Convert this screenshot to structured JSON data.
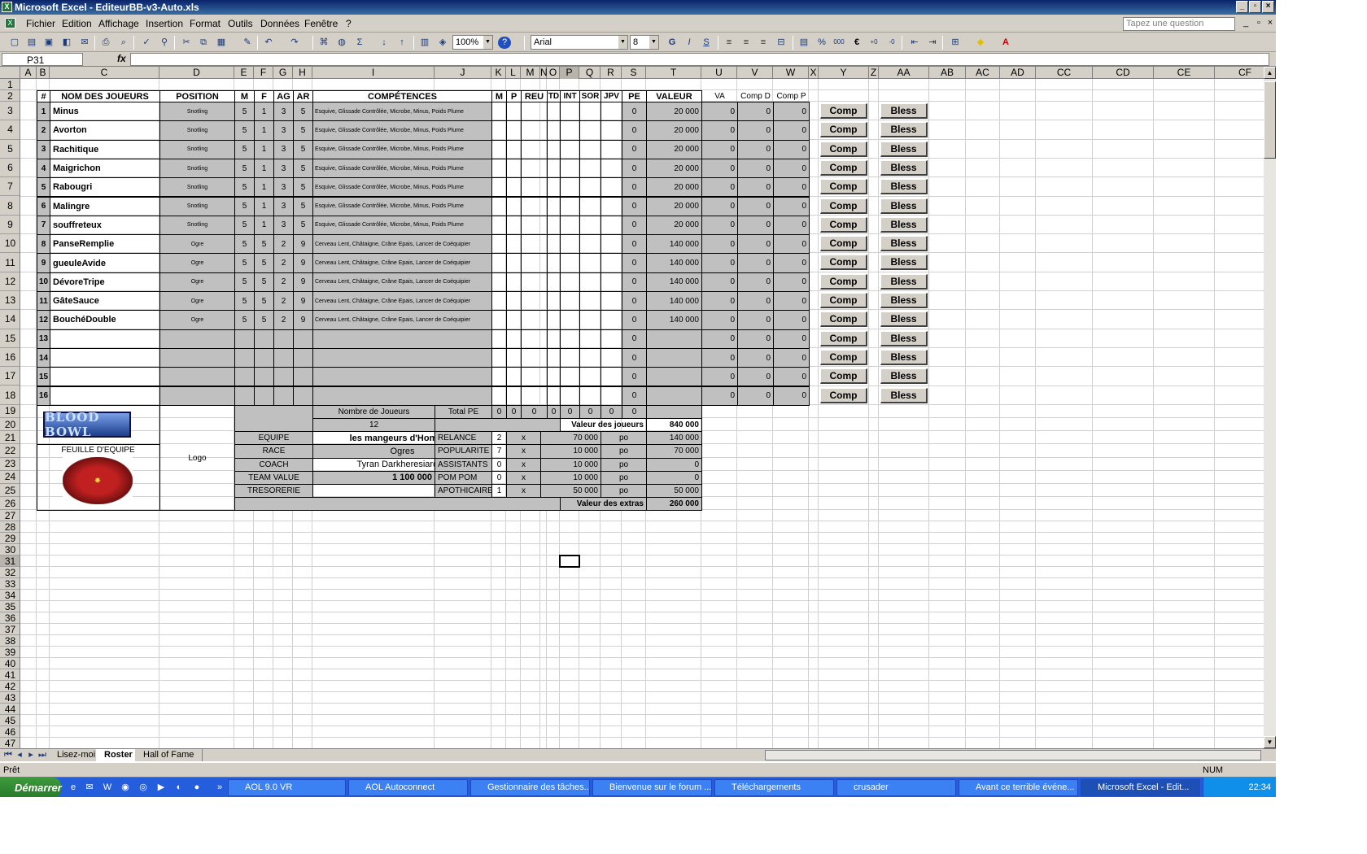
{
  "window": {
    "title": "Microsoft Excel - EditeurBB-v3-Auto.xls"
  },
  "menu": [
    "Fichier",
    "Edition",
    "Affichage",
    "Insertion",
    "Format",
    "Outils",
    "Données",
    "Fenêtre",
    "?"
  ],
  "ask": "Tapez une question",
  "toolbar": {
    "zoom": "100%",
    "font": "Arial",
    "size": "8",
    "euro": "€"
  },
  "namebox": "P31",
  "fx": "fx",
  "columns": [
    "A",
    "B",
    "C",
    "D",
    "E",
    "F",
    "G",
    "H",
    "I",
    "J",
    "K",
    "L",
    "M",
    "N",
    "O",
    "P",
    "Q",
    "R",
    "S",
    "T",
    "U",
    "V",
    "W",
    "X",
    "Y",
    "Z",
    "AA",
    "AB",
    "AC",
    "AD",
    "CC",
    "CD",
    "CE",
    "CF"
  ],
  "rownums": [
    "1",
    "2",
    "3",
    "4",
    "5",
    "6",
    "7",
    "8",
    "9",
    "10",
    "11",
    "12",
    "13",
    "14",
    "15",
    "16",
    "17",
    "18",
    "19",
    "20",
    "21",
    "22",
    "23",
    "24",
    "25",
    "26",
    "27",
    "28",
    "29",
    "30",
    "31",
    "32",
    "33",
    "34",
    "35",
    "36",
    "37",
    "38",
    "39",
    "40",
    "41",
    "42",
    "43",
    "44",
    "45",
    "46",
    "47"
  ],
  "headers": {
    "num": "#",
    "name": "NOM DES JOUEURS",
    "position": "POSITION",
    "m": "M",
    "f": "F",
    "ag": "AG",
    "ar": "AR",
    "comp": "COMPÉTENCES",
    "m2": "M",
    "p": "P",
    "reu": "REU",
    "td": "TD",
    "int": "INT",
    "sor": "SOR",
    "jpv": "JPV",
    "pe": "PE",
    "valeur": "VALEUR",
    "va": "VA",
    "compd": "Comp D",
    "compp": "Comp P"
  },
  "players": [
    {
      "n": "1",
      "name": "Minus",
      "pos": "Snotling",
      "m": "5",
      "f": "1",
      "ag": "3",
      "ar": "5",
      "comp": "Esquive, Glissade Contrôlée, Microbe, Minus, Poids Plume",
      "pe": "0",
      "val": "20 000",
      "va": "0",
      "cd": "0",
      "cp": "0"
    },
    {
      "n": "2",
      "name": "Avorton",
      "pos": "Snotling",
      "m": "5",
      "f": "1",
      "ag": "3",
      "ar": "5",
      "comp": "Esquive, Glissade Contrôlée, Microbe, Minus, Poids Plume",
      "pe": "0",
      "val": "20 000",
      "va": "0",
      "cd": "0",
      "cp": "0"
    },
    {
      "n": "3",
      "name": "Rachitique",
      "pos": "Snotling",
      "m": "5",
      "f": "1",
      "ag": "3",
      "ar": "5",
      "comp": "Esquive, Glissade Contrôlée, Microbe, Minus, Poids Plume",
      "pe": "0",
      "val": "20 000",
      "va": "0",
      "cd": "0",
      "cp": "0"
    },
    {
      "n": "4",
      "name": "Maigrichon",
      "pos": "Snotling",
      "m": "5",
      "f": "1",
      "ag": "3",
      "ar": "5",
      "comp": "Esquive, Glissade Contrôlée, Microbe, Minus, Poids Plume",
      "pe": "0",
      "val": "20 000",
      "va": "0",
      "cd": "0",
      "cp": "0"
    },
    {
      "n": "5",
      "name": "Rabougri",
      "pos": "Snotling",
      "m": "5",
      "f": "1",
      "ag": "3",
      "ar": "5",
      "comp": "Esquive, Glissade Contrôlée, Microbe, Minus, Poids Plume",
      "pe": "0",
      "val": "20 000",
      "va": "0",
      "cd": "0",
      "cp": "0"
    },
    {
      "n": "6",
      "name": "Malingre",
      "pos": "Snotling",
      "m": "5",
      "f": "1",
      "ag": "3",
      "ar": "5",
      "comp": "Esquive, Glissade Contrôlée, Microbe, Minus, Poids Plume",
      "pe": "0",
      "val": "20 000",
      "va": "0",
      "cd": "0",
      "cp": "0"
    },
    {
      "n": "7",
      "name": "souffreteux",
      "pos": "Snotling",
      "m": "5",
      "f": "1",
      "ag": "3",
      "ar": "5",
      "comp": "Esquive, Glissade Contrôlée, Microbe, Minus, Poids Plume",
      "pe": "0",
      "val": "20 000",
      "va": "0",
      "cd": "0",
      "cp": "0"
    },
    {
      "n": "8",
      "name": "PanseRemplie",
      "pos": "Ogre",
      "m": "5",
      "f": "5",
      "ag": "2",
      "ar": "9",
      "comp": "Cerveau Lent, Châtaigne, Crâne Epais, Lancer de Coéquipier",
      "pe": "0",
      "val": "140 000",
      "va": "0",
      "cd": "0",
      "cp": "0"
    },
    {
      "n": "9",
      "name": "gueuleAvide",
      "pos": "Ogre",
      "m": "5",
      "f": "5",
      "ag": "2",
      "ar": "9",
      "comp": "Cerveau Lent, Châtaigne, Crâne Epais, Lancer de Coéquipier",
      "pe": "0",
      "val": "140 000",
      "va": "0",
      "cd": "0",
      "cp": "0"
    },
    {
      "n": "10",
      "name": "DévoreTripe",
      "pos": "Ogre",
      "m": "5",
      "f": "5",
      "ag": "2",
      "ar": "9",
      "comp": "Cerveau Lent, Châtaigne, Crâne Epais, Lancer de Coéquipier",
      "pe": "0",
      "val": "140 000",
      "va": "0",
      "cd": "0",
      "cp": "0"
    },
    {
      "n": "11",
      "name": "GâteSauce",
      "pos": "Ogre",
      "m": "5",
      "f": "5",
      "ag": "2",
      "ar": "9",
      "comp": "Cerveau Lent, Châtaigne, Crâne Epais, Lancer de Coéquipier",
      "pe": "0",
      "val": "140 000",
      "va": "0",
      "cd": "0",
      "cp": "0"
    },
    {
      "n": "12",
      "name": "BouchéDouble",
      "pos": "Ogre",
      "m": "5",
      "f": "5",
      "ag": "2",
      "ar": "9",
      "comp": "Cerveau Lent, Châtaigne, Crâne Epais, Lancer de Coéquipier",
      "pe": "0",
      "val": "140 000",
      "va": "0",
      "cd": "0",
      "cp": "0"
    },
    {
      "n": "13",
      "name": "",
      "pos": "",
      "m": "",
      "f": "",
      "ag": "",
      "ar": "",
      "comp": "",
      "pe": "0",
      "val": "",
      "va": "0",
      "cd": "0",
      "cp": "0"
    },
    {
      "n": "14",
      "name": "",
      "pos": "",
      "m": "",
      "f": "",
      "ag": "",
      "ar": "",
      "comp": "",
      "pe": "0",
      "val": "",
      "va": "0",
      "cd": "0",
      "cp": "0"
    },
    {
      "n": "15",
      "name": "",
      "pos": "",
      "m": "",
      "f": "",
      "ag": "",
      "ar": "",
      "comp": "",
      "pe": "0",
      "val": "",
      "va": "0",
      "cd": "0",
      "cp": "0"
    },
    {
      "n": "16",
      "name": "",
      "pos": "",
      "m": "",
      "f": "",
      "ag": "",
      "ar": "",
      "comp": "",
      "pe": "0",
      "val": "",
      "va": "0",
      "cd": "0",
      "cp": "0"
    }
  ],
  "buttons": {
    "comp": "Comp",
    "bless": "Bless"
  },
  "team": {
    "bb_logo": "BLOOD BOWL",
    "feuille": "FEUILLE D'EQUIPE",
    "logo": "Logo",
    "nb_joueurs_label": "Nombre de Joueurs",
    "nb_joueurs": "12",
    "total_pe_label": "Total PE",
    "total_pe_vals": [
      "0",
      "0",
      "0",
      "0",
      "0",
      "0",
      "0",
      "0"
    ],
    "valeur_joueurs_label": "Valeur des joueurs",
    "valeur_joueurs": "840 000",
    "equipe_label": "EQUIPE",
    "equipe": "les mangeurs d'Hommes",
    "race_label": "RACE",
    "race": "Ogres",
    "coach_label": "COACH",
    "coach": "Tyran Darkheresiarque",
    "tv_label": "TEAM VALUE",
    "tv": "1 100 000",
    "po": "po",
    "treso_label": "TRESORERIE",
    "extras": [
      {
        "label": "RELANCE",
        "qty": "2",
        "x": "x",
        "price": "70 000",
        "po": "po",
        "total": "140 000"
      },
      {
        "label": "POPULARITE",
        "qty": "7",
        "x": "x",
        "price": "10 000",
        "po": "po",
        "total": "70 000"
      },
      {
        "label": "ASSISTANTS",
        "qty": "0",
        "x": "x",
        "price": "10 000",
        "po": "po",
        "total": "0"
      },
      {
        "label": "POM POM",
        "qty": "0",
        "x": "x",
        "price": "10 000",
        "po": "po",
        "total": "0"
      },
      {
        "label": "APOTHICAIRE",
        "qty": "1",
        "x": "x",
        "price": "50 000",
        "po": "po",
        "total": "50 000"
      }
    ],
    "valeur_extras_label": "Valeur des extras",
    "valeur_extras": "260 000"
  },
  "sheets": [
    "Lisez-moi",
    "Roster",
    "Hall of Fame"
  ],
  "status": {
    "left": "Prêt",
    "num": "NUM"
  },
  "taskbar": {
    "start": "Démarrer",
    "items": [
      "AOL 9.0 VR",
      "AOL Autoconnect",
      "Gestionnaire des tâches...",
      "Bienvenue sur le forum ...",
      "Téléchargements",
      "crusader",
      "Avant ce terrible événe...",
      "Microsoft Excel - Edit..."
    ],
    "time": "22:34"
  }
}
